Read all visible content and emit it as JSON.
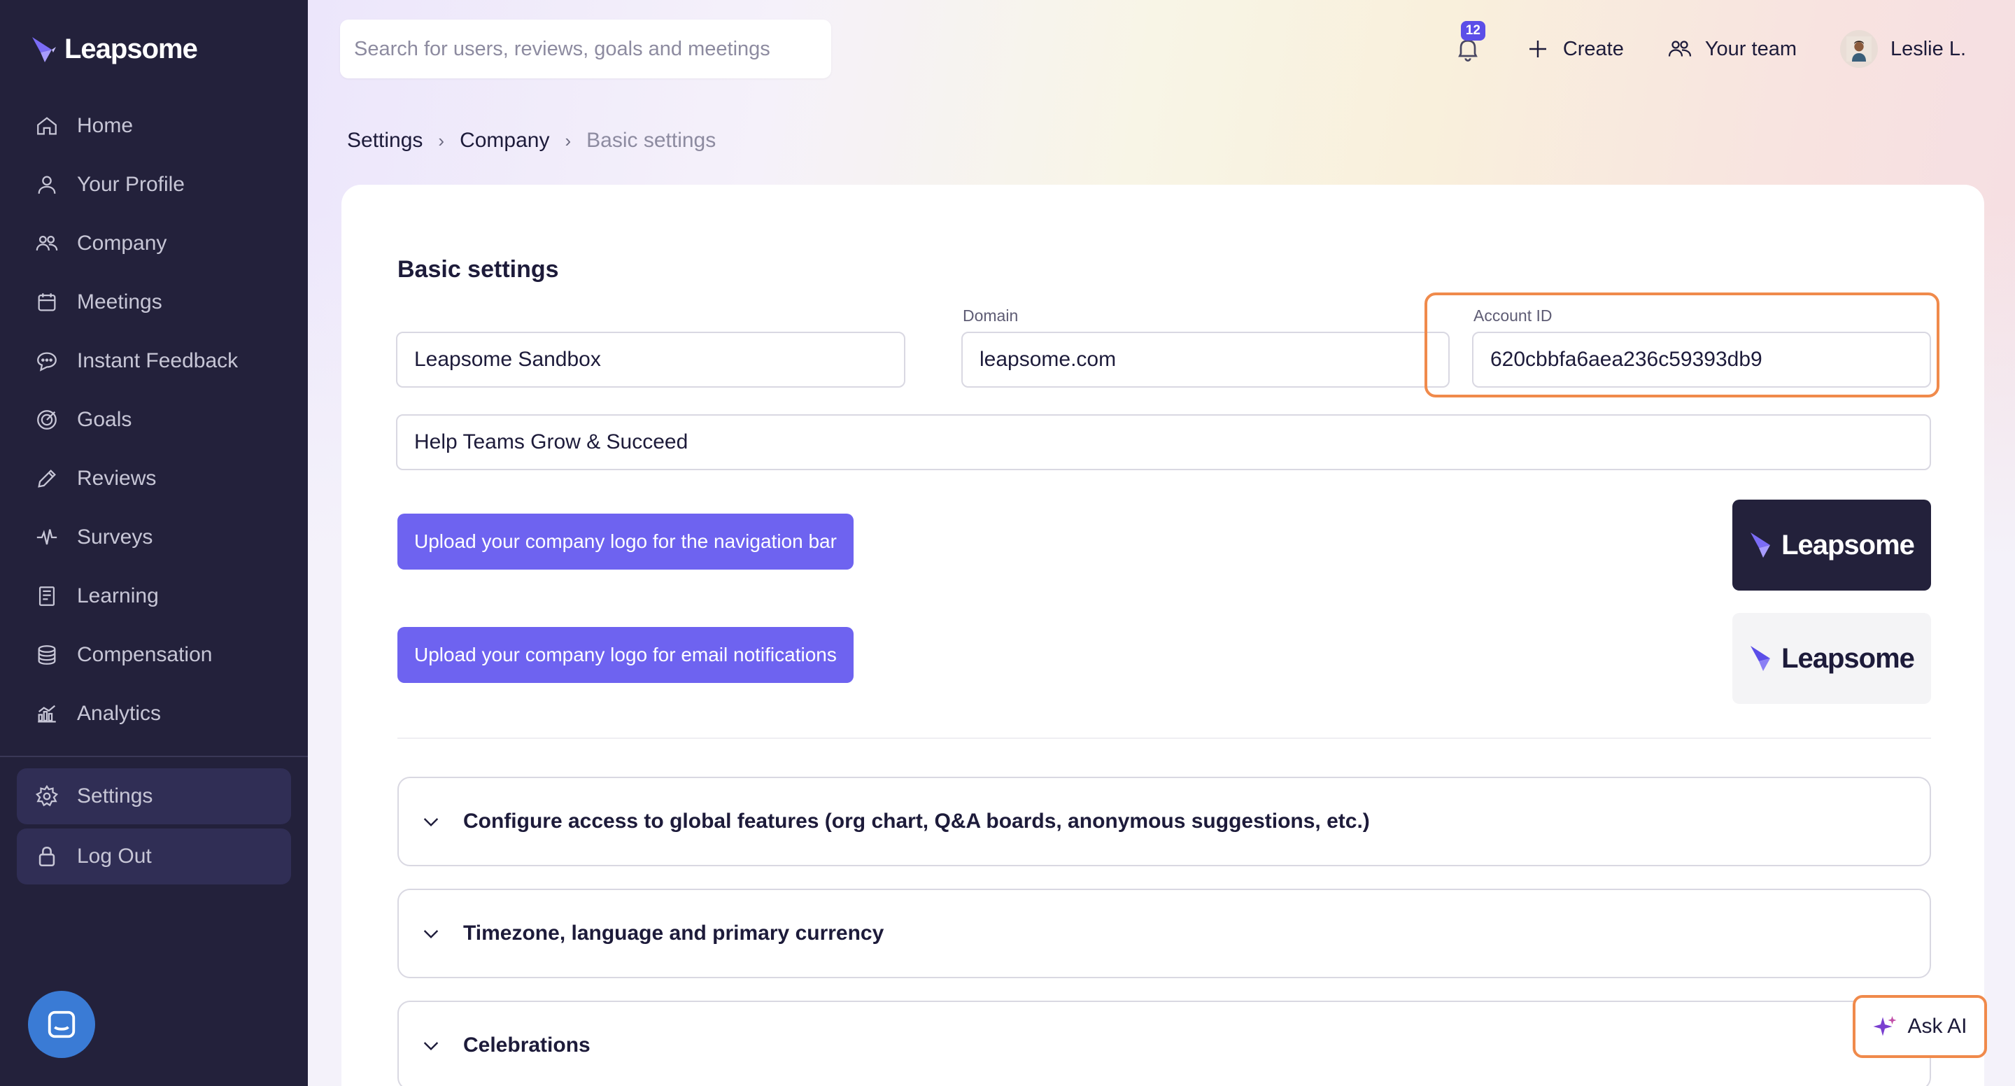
{
  "brand": {
    "name": "Leapsome"
  },
  "sidebar": {
    "items": [
      {
        "label": "Home",
        "icon": "home-icon"
      },
      {
        "label": "Your Profile",
        "icon": "user-icon"
      },
      {
        "label": "Company",
        "icon": "users-icon"
      },
      {
        "label": "Meetings",
        "icon": "calendar-icon"
      },
      {
        "label": "Instant Feedback",
        "icon": "chat-icon"
      },
      {
        "label": "Goals",
        "icon": "target-icon"
      },
      {
        "label": "Reviews",
        "icon": "pencil-icon"
      },
      {
        "label": "Surveys",
        "icon": "pulse-icon"
      },
      {
        "label": "Learning",
        "icon": "book-icon"
      },
      {
        "label": "Compensation",
        "icon": "coins-icon"
      },
      {
        "label": "Analytics",
        "icon": "chart-icon"
      }
    ],
    "bottom": [
      {
        "label": "Settings",
        "icon": "gear-icon"
      },
      {
        "label": "Log Out",
        "icon": "lock-icon"
      }
    ]
  },
  "search": {
    "placeholder": "Search for users, reviews, goals and meetings"
  },
  "topbar": {
    "notifications_count": "12",
    "create_label": "Create",
    "team_label": "Your team",
    "user_name": "Leslie L."
  },
  "breadcrumb": {
    "items": [
      "Settings",
      "Company",
      "Basic settings"
    ],
    "separator": "›"
  },
  "settings": {
    "title": "Basic settings",
    "company_name": "Leapsome Sandbox",
    "domain_label": "Domain",
    "domain": "leapsome.com",
    "account_id_label": "Account ID",
    "account_id": "620cbbfa6aea236c59393db9",
    "tagline": "Help Teams Grow & Succeed",
    "upload_nav_logo": "Upload your company logo for the navigation bar",
    "upload_email_logo": "Upload your company logo for email notifications",
    "accordions": [
      "Configure access to global features (org chart, Q&A boards, anonymous suggestions, etc.)",
      "Timezone, language and primary currency",
      "Celebrations"
    ]
  },
  "ask_ai": {
    "label": "Ask AI"
  },
  "colors": {
    "accent": "#6e63f0",
    "sidebar": "#23213b",
    "highlight": "#f08a4b",
    "badge": "#5b4ee8"
  }
}
